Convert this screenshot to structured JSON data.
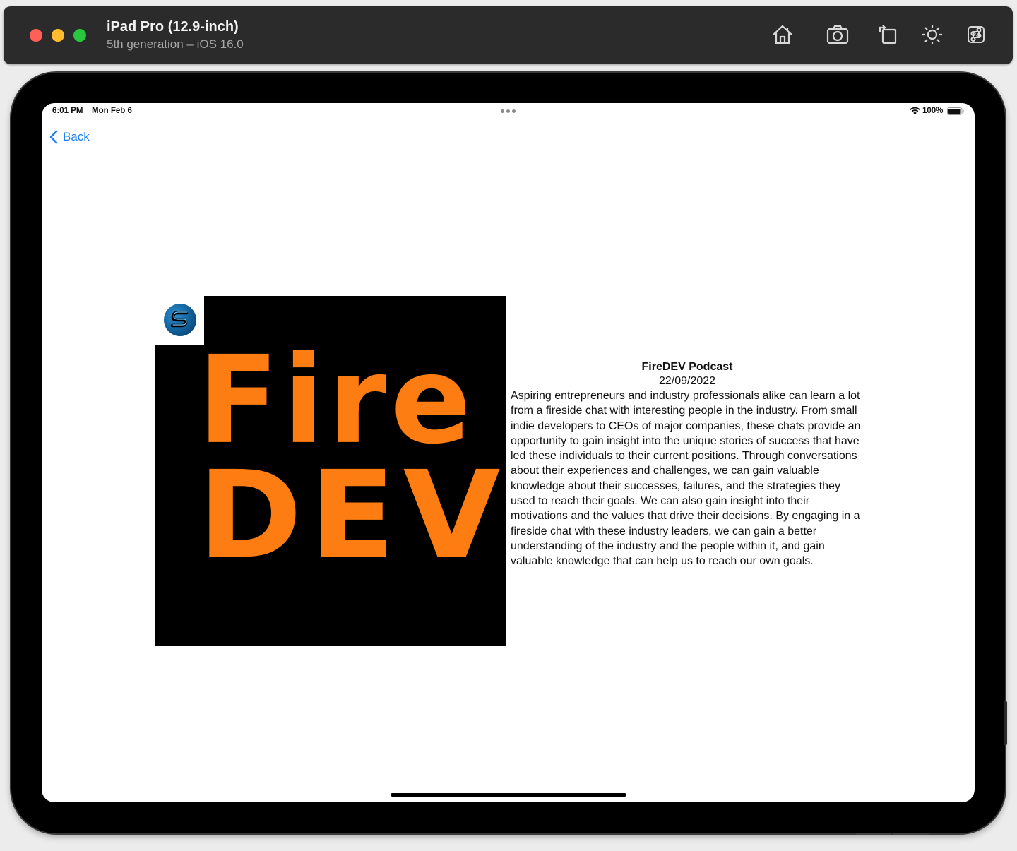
{
  "simulator": {
    "device_name": "iPad Pro (12.9-inch)",
    "device_subtitle": "5th generation – iOS 16.0",
    "toolbar": [
      {
        "name": "home-icon"
      },
      {
        "name": "screenshot-icon"
      },
      {
        "name": "rotate-icon"
      },
      {
        "name": "appearance-icon"
      },
      {
        "name": "command-icon"
      }
    ]
  },
  "status_bar": {
    "time": "6:01 PM",
    "date": "Mon Feb 6",
    "battery": "100%"
  },
  "nav": {
    "back_label": "Back"
  },
  "artwork": {
    "line1": "Fire",
    "line2": "DEV",
    "text_color": "#fd7d12",
    "background": "#000000"
  },
  "episode": {
    "title": "FireDEV Podcast",
    "date": "22/09/2022",
    "description": "Aspiring entrepreneurs and industry professionals alike can learn a lot from a fireside chat with interesting people in the industry. From small indie developers to CEOs of major companies, these chats provide an opportunity to gain insight into the unique stories of success that have led these individuals to their current positions. Through conversations about their experiences and challenges, we can gain valuable knowledge about their successes, failures, and the strategies they used to reach their goals. We can also gain insight into their motivations and the values that drive their decisions. By engaging in a fireside chat with these industry leaders, we can gain a better understanding of the industry and the people within it, and gain valuable knowledge that can help us to reach our own goals."
  },
  "colors": {
    "accent": "#1f7ff5"
  }
}
